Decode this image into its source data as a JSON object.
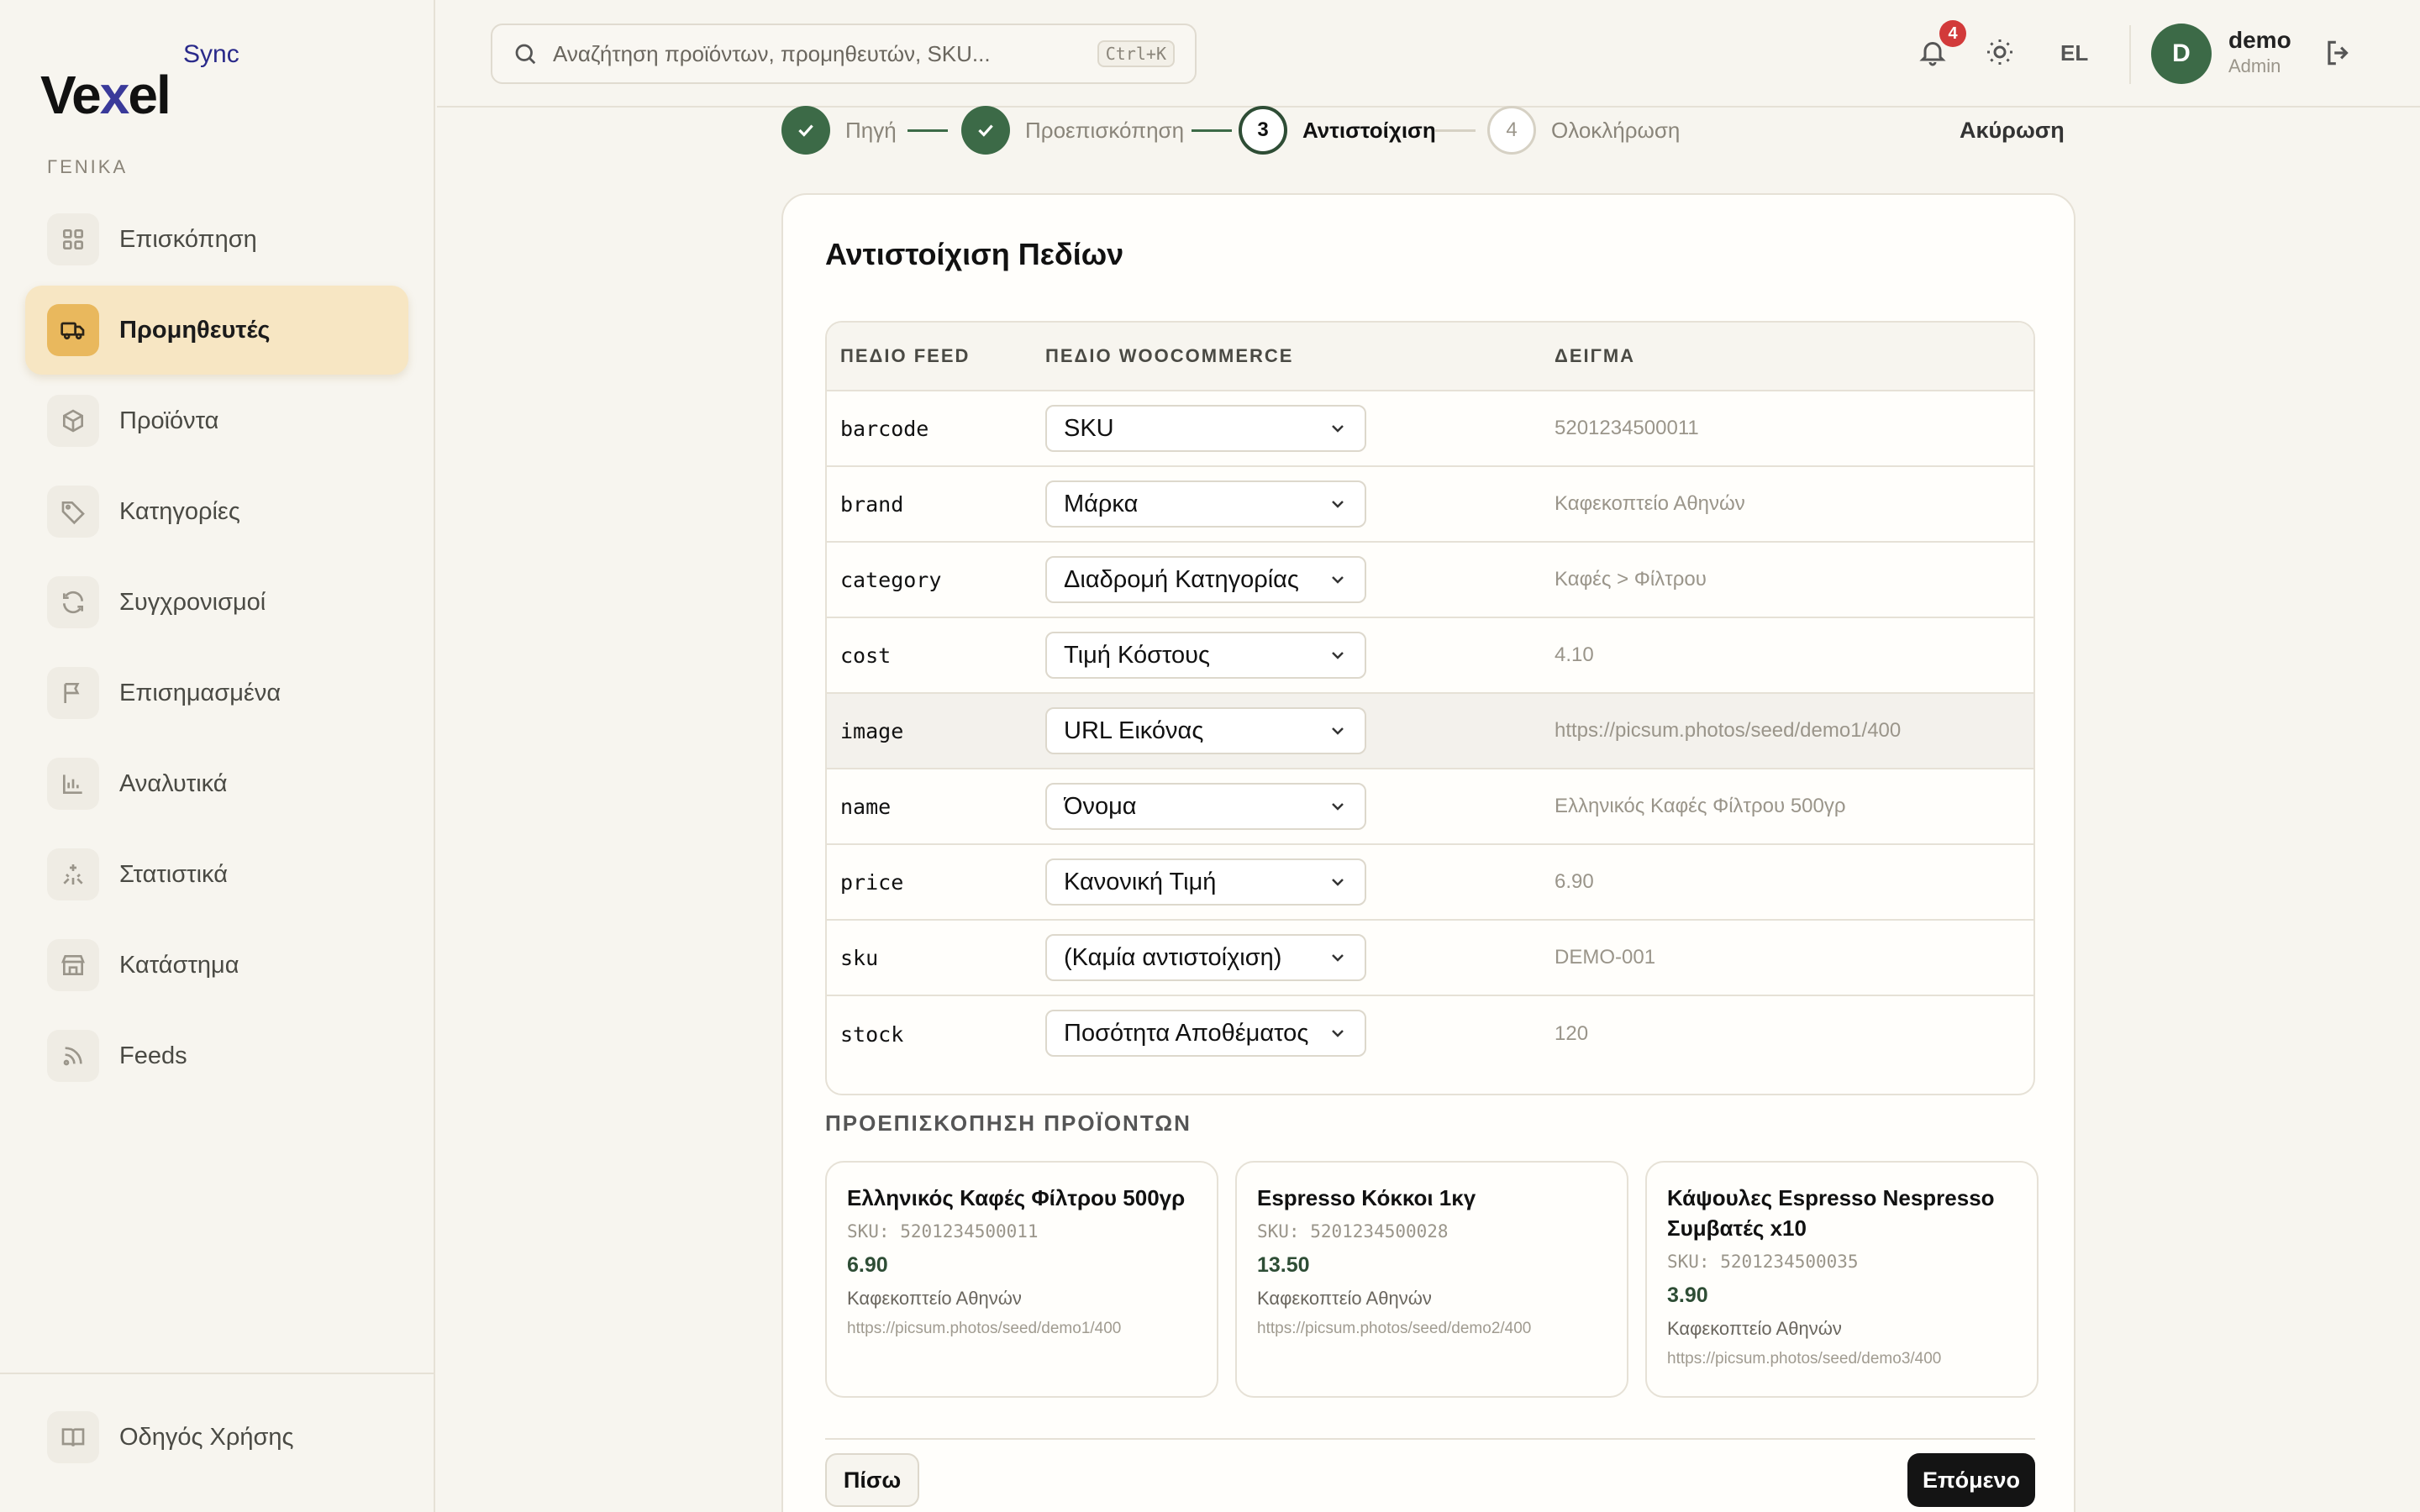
{
  "brand": {
    "name_pre": "Ve",
    "name_x": "x",
    "name_post": "el",
    "sync": "Sync"
  },
  "sidebar": {
    "section": "ΓΕΝΙΚΑ",
    "items": [
      {
        "label": "Επισκόπηση",
        "icon": "grid-icon"
      },
      {
        "label": "Προμηθευτές",
        "icon": "truck-icon",
        "active": true
      },
      {
        "label": "Προϊόντα",
        "icon": "box-icon"
      },
      {
        "label": "Κατηγορίες",
        "icon": "tag-icon"
      },
      {
        "label": "Συγχρονισμοί",
        "icon": "refresh-icon"
      },
      {
        "label": "Επισημασμένα",
        "icon": "flag-icon"
      },
      {
        "label": "Αναλυτικά",
        "icon": "bar-chart-icon"
      },
      {
        "label": "Στατιστικά",
        "icon": "sparkles-icon"
      },
      {
        "label": "Κατάστημα",
        "icon": "store-icon"
      },
      {
        "label": "Feeds",
        "icon": "rss-icon"
      }
    ],
    "guide": "Οδηγός Χρήσης"
  },
  "topbar": {
    "search_placeholder": "Αναζήτηση προϊόντων, προμηθευτών, SKU...",
    "shortcut": "Ctrl+K",
    "notifications": "4",
    "lang": "EL",
    "avatar_letter": "D",
    "user_name": "demo",
    "user_role": "Admin"
  },
  "stepper": {
    "steps": [
      {
        "num": "1",
        "label": "Πηγή",
        "state": "done"
      },
      {
        "num": "2",
        "label": "Προεπισκόπηση",
        "state": "done"
      },
      {
        "num": "3",
        "label": "Αντιστοίχιση",
        "state": "current"
      },
      {
        "num": "4",
        "label": "Ολοκλήρωση",
        "state": "todo"
      }
    ],
    "cancel": "Ακύρωση"
  },
  "mapping": {
    "title": "Αντιστοίχιση Πεδίων",
    "headers": {
      "feed": "ΠΕΔΙΟ FEED",
      "woo": "ΠΕΔΙΟ WOOCOMMERCE",
      "sample": "ΔΕΙΓΜΑ"
    },
    "rows": [
      {
        "feed": "barcode",
        "woo": "SKU",
        "sample": "5201234500011"
      },
      {
        "feed": "brand",
        "woo": "Μάρκα",
        "sample": "Καφεκοπτείο Αθηνών"
      },
      {
        "feed": "category",
        "woo": "Διαδρομή Κατηγορίας",
        "sample": "Καφές > Φίλτρου"
      },
      {
        "feed": "cost",
        "woo": "Τιμή Κόστους",
        "sample": "4.10"
      },
      {
        "feed": "image",
        "woo": "URL Εικόνας",
        "sample": "https://picsum.photos/seed/demo1/400"
      },
      {
        "feed": "name",
        "woo": "Όνομα",
        "sample": "Ελληνικός Καφές Φίλτρου 500γρ"
      },
      {
        "feed": "price",
        "woo": "Κανονική Τιμή",
        "sample": "6.90"
      },
      {
        "feed": "sku",
        "woo": "(Καμία αντιστοίχιση)",
        "sample": "DEMO-001"
      },
      {
        "feed": "stock",
        "woo": "Ποσότητα Αποθέματος",
        "sample": "120"
      }
    ]
  },
  "preview": {
    "title": "ΠΡΟΕΠΙΣΚΟΠΗΣΗ ΠΡΟΪΟΝΤΩΝ",
    "products": [
      {
        "name": "Ελληνικός Καφές Φίλτρου 500γρ",
        "sku": "SKU: 5201234500011",
        "price": "6.90",
        "brand": "Καφεκοπτείο Αθηνών",
        "url": "https://picsum.photos/seed/demo1/400"
      },
      {
        "name": "Espresso Κόκκοι 1κγ",
        "sku": "SKU: 5201234500028",
        "price": "13.50",
        "brand": "Καφεκοπτείο Αθηνών",
        "url": "https://picsum.photos/seed/demo2/400"
      },
      {
        "name": "Κάψουλες Espresso Nespresso Συμβατές x10",
        "sku": "SKU: 5201234500035",
        "price": "3.90",
        "brand": "Καφεκοπτείο Αθηνών",
        "url": "https://picsum.photos/seed/demo3/400"
      }
    ]
  },
  "actions": {
    "back": "Πίσω",
    "next": "Επόμενο"
  }
}
